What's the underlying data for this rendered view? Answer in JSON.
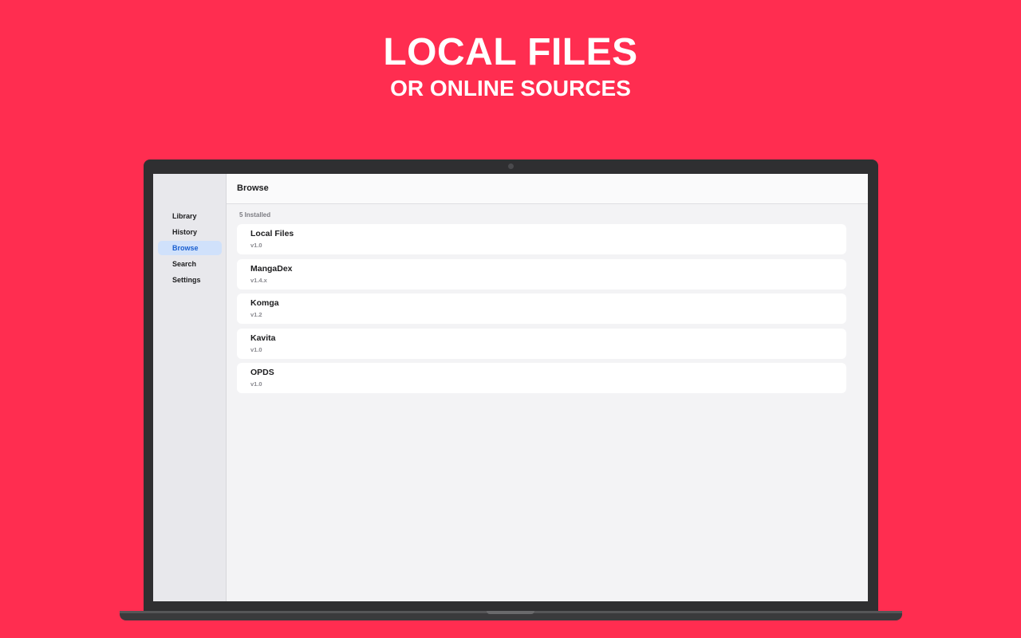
{
  "promo": {
    "headline": "LOCAL FILES",
    "subheadline": "OR ONLINE SOURCES"
  },
  "sidebar": {
    "items": [
      {
        "label": "Library",
        "active": false
      },
      {
        "label": "History",
        "active": false
      },
      {
        "label": "Browse",
        "active": true
      },
      {
        "label": "Search",
        "active": false
      },
      {
        "label": "Settings",
        "active": false
      }
    ]
  },
  "header": {
    "title": "Browse"
  },
  "sources": {
    "section_label": "5 Installed",
    "items": [
      {
        "name": "Local Files",
        "version": "v1.0"
      },
      {
        "name": "MangaDex",
        "version": "v1.4.x"
      },
      {
        "name": "Komga",
        "version": "v1.2"
      },
      {
        "name": "Kavita",
        "version": "v1.0"
      },
      {
        "name": "OPDS",
        "version": "v1.0"
      }
    ]
  },
  "colors": {
    "background": "#ff2d50",
    "accent": "#1a5fd0",
    "active_bg": "#d0e1fb"
  }
}
